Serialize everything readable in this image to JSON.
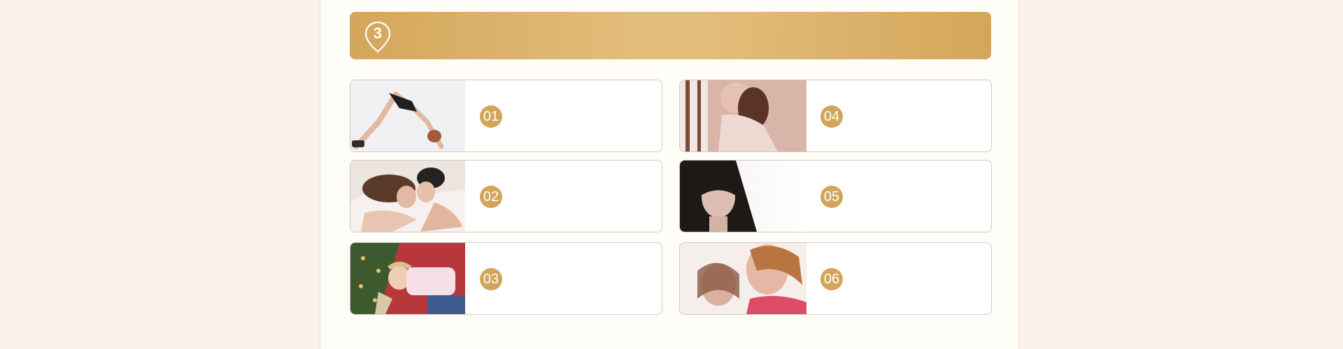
{
  "section": {
    "number": "3"
  },
  "items": [
    {
      "number": "01",
      "photo": "yoga-pose-photo"
    },
    {
      "number": "02",
      "photo": "couple-in-bed-photo"
    },
    {
      "number": "03",
      "photo": "child-christmas-tree-photo"
    },
    {
      "number": "04",
      "photo": "woman-by-window-photo"
    },
    {
      "number": "05",
      "photo": "sad-girl-photo"
    },
    {
      "number": "06",
      "photo": "two-women-talking-photo"
    }
  ],
  "colors": {
    "accent": "#d1a55a",
    "banner_light": "#e3bd7a",
    "page_bg": "#fbf3e9",
    "panel_bg": "#fffdf8"
  }
}
